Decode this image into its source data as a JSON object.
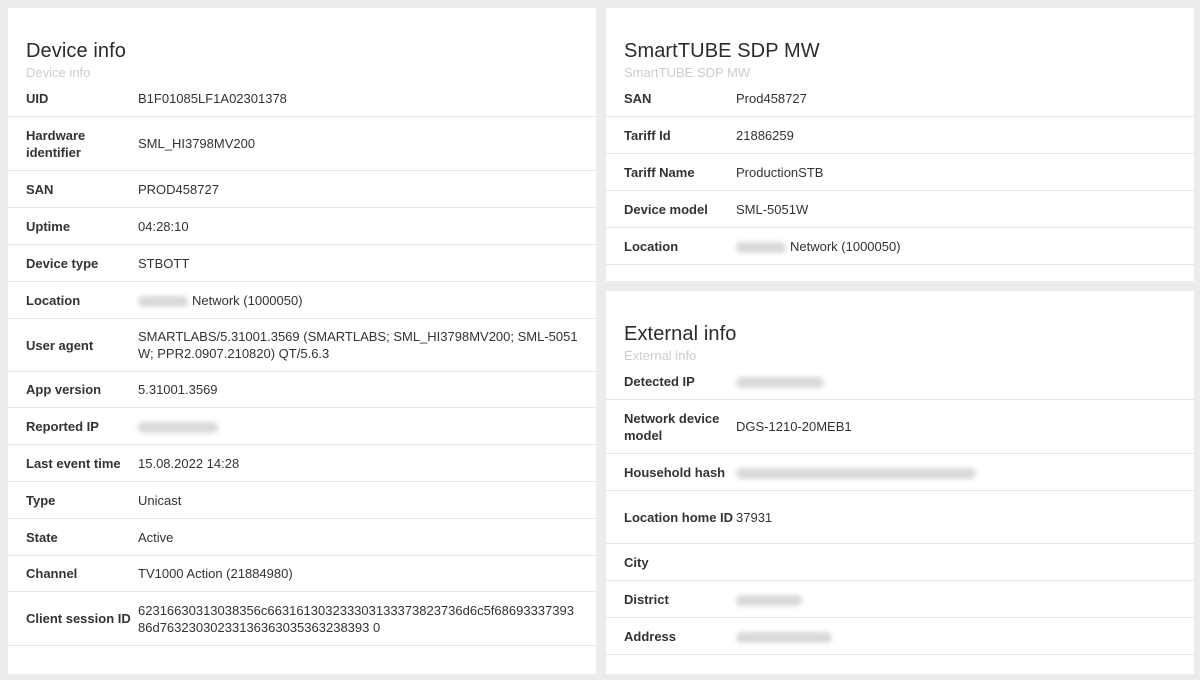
{
  "device_info": {
    "title": "Device info",
    "subtitle": "Device info",
    "rows": [
      {
        "label": "UID",
        "value": "B1F01085LF1A02301378"
      },
      {
        "label": "Hardware identifier",
        "value": "SML_HI3798MV200"
      },
      {
        "label": "SAN",
        "value": "PROD458727"
      },
      {
        "label": "Uptime",
        "value": "04:28:10"
      },
      {
        "label": "Device type",
        "value": "STBOTT"
      },
      {
        "label": "Location",
        "value": "Network (1000050)"
      },
      {
        "label": "User agent",
        "value": "SMARTLABS/5.31001.3569 (SMARTLABS; SML_HI3798MV200; SML-5051W; PPR2.0907.210820) QT/5.6.3"
      },
      {
        "label": "App version",
        "value": "5.31001.3569"
      },
      {
        "label": "Reported IP",
        "value": ""
      },
      {
        "label": "Last event time",
        "value": "15.08.2022 14:28"
      },
      {
        "label": "Type",
        "value": "Unicast"
      },
      {
        "label": "State",
        "value": "Active"
      },
      {
        "label": "Channel",
        "value": "TV1000 Action (21884980)"
      },
      {
        "label": "Client session ID",
        "value": "62316630313038356c663161303233303133373823736d6c5f6869333739386d76323030233136363035363238393 0"
      }
    ]
  },
  "smarttube": {
    "title": "SmartTUBE SDP MW",
    "subtitle": "SmartTUBE SDP MW",
    "rows": [
      {
        "label": "SAN",
        "value": "Prod458727"
      },
      {
        "label": "Tariff Id",
        "value": "21886259"
      },
      {
        "label": "Tariff Name",
        "value": "ProductionSTB"
      },
      {
        "label": "Device model",
        "value": "SML-5051W"
      },
      {
        "label": "Location",
        "value": "Network (1000050)"
      }
    ]
  },
  "external_info": {
    "title": "External info",
    "subtitle": "External info",
    "rows": [
      {
        "label": "Detected IP",
        "value": ""
      },
      {
        "label": "Network device model",
        "value": "DGS-1210-20MEB1"
      },
      {
        "label": "Household hash",
        "value": ""
      },
      {
        "label": "Location home ID",
        "value": "37931"
      },
      {
        "label": "City",
        "value": ""
      },
      {
        "label": "District",
        "value": ""
      },
      {
        "label": "Address",
        "value": ""
      }
    ]
  }
}
